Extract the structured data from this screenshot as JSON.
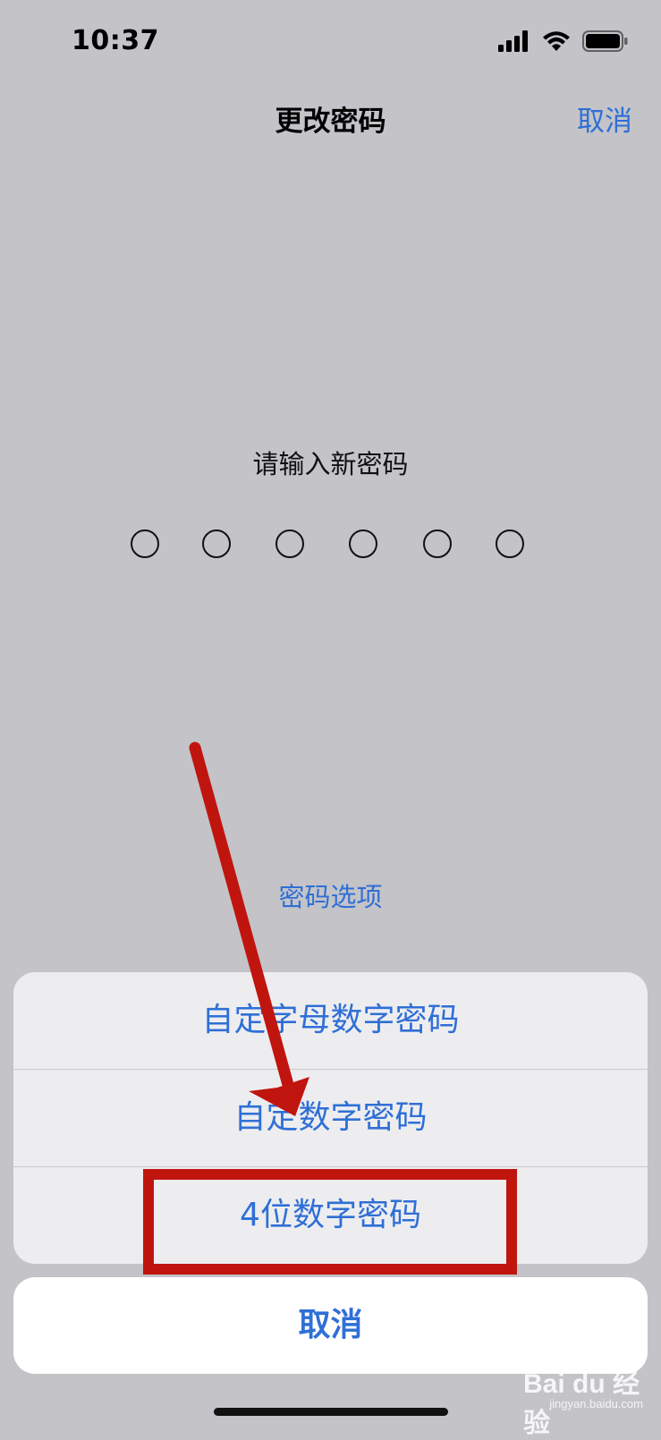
{
  "status_bar": {
    "time": "10:37",
    "icons": [
      "cellular-signal-icon",
      "wifi-icon",
      "battery-icon"
    ]
  },
  "nav": {
    "title": "更改密码",
    "cancel_label": "取消"
  },
  "passcode": {
    "prompt": "请输入新密码",
    "digit_count": 6,
    "filled_count": 0
  },
  "options_link": "密码选项",
  "action_sheet": {
    "items": [
      {
        "label": "自定字母数字密码"
      },
      {
        "label": "自定数字密码"
      },
      {
        "label": "4位数字密码",
        "highlighted": true
      }
    ],
    "cancel_label": "取消"
  },
  "annotation": {
    "arrow_color": "#c0150e",
    "box_color": "#c0150e"
  },
  "watermark": {
    "main": "Bai du 经验",
    "sub": "jingyan.baidu.com"
  },
  "colors": {
    "accent": "#2f6fd6",
    "background": "#c3c3c8",
    "sheet": "#ededf0"
  }
}
